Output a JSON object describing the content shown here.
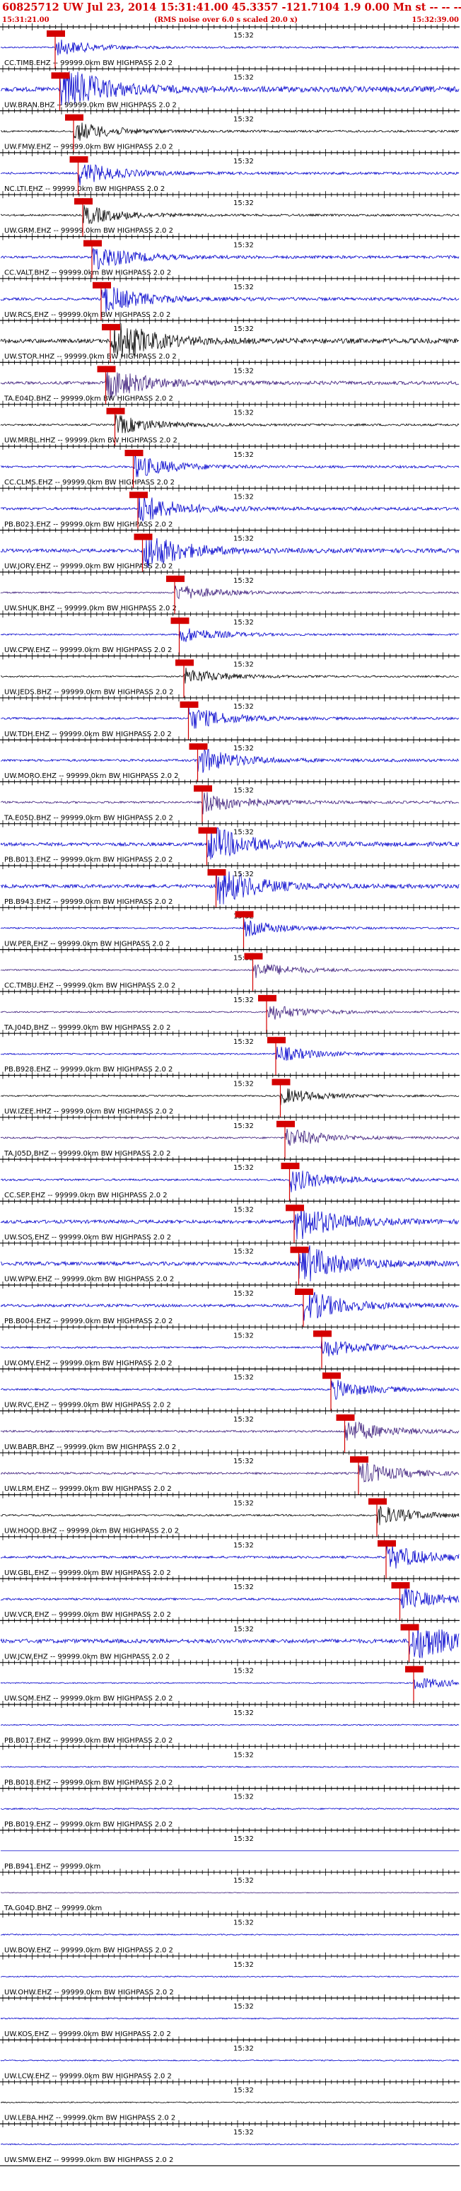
{
  "header": {
    "title": "60825712 UW Jul 23, 2014 15:31:41.00    45.3357 -121.7104   1.9 0.00 Mn st -- -- -- - -1",
    "start_time": "15:31:21.00",
    "rms_note": "(RMS noise over 6.0 s scaled 20.0 x)",
    "end_time": "15:32:39.00"
  },
  "colors": {
    "header": "#d40000",
    "pick": "#d40000",
    "mid_time": "#000000"
  },
  "mid_time_label": "15:32",
  "chart_data": {
    "type": "seismogram-record-section",
    "time_range": [
      "15:31:21.00",
      "15:32:39.00"
    ],
    "grid": true,
    "traces": [
      {
        "label": "CC.TIMB.EHZ -- 99999.0km BW  HIGHPASS  2.0  2",
        "color": "#0000cc",
        "pick": 0.12,
        "amp": 0.5
      },
      {
        "label": "UW.BRAN.BHZ -- 99999.0km BW  HIGHPASS  2.0  2",
        "color": "#0000cc",
        "pick": 0.13,
        "amp": 1.6
      },
      {
        "label": "UW.FMW.EHZ -- 99999.0km BW  HIGHPASS  2.0  2",
        "color": "#000000",
        "pick": 0.16,
        "amp": 0.6
      },
      {
        "label": "NC.LTI.EHZ -- 99999.0km BW  HIGHPASS  2.0  2",
        "color": "#0000cc",
        "pick": 0.17,
        "amp": 0.7
      },
      {
        "label": "UW.GRM.EHZ -- 99999.0km BW  HIGHPASS  2.0  2",
        "color": "#000000",
        "pick": 0.18,
        "amp": 0.6
      },
      {
        "label": "CC.VALT.BHZ -- 99999.0km BW  HIGHPASS  2.0  2",
        "color": "#0000cc",
        "pick": 0.2,
        "amp": 0.8
      },
      {
        "label": "UW.RCS.EHZ -- 99999.0km BW  HIGHPASS  2.0  2",
        "color": "#0000cc",
        "pick": 0.22,
        "amp": 0.9
      },
      {
        "label": "UW.STOR.HHZ -- 99999.0km BW  HIGHPASS  2.0  2",
        "color": "#000000",
        "pick": 0.24,
        "amp": 1.4
      },
      {
        "label": "TA.E04D.BHZ -- 99999.0km BW  HIGHPASS  2.0  2",
        "color": "#3a1a7a",
        "pick": 0.23,
        "amp": 1.0
      },
      {
        "label": "UW.MRBL.HHZ -- 99999.0km BW  HIGHPASS  2.0  2",
        "color": "#000000",
        "pick": 0.25,
        "amp": 0.6
      },
      {
        "label": "CC.CLMS.EHZ -- 99999.0km BW  HIGHPASS  2.0  2",
        "color": "#0000cc",
        "pick": 0.29,
        "amp": 0.7
      },
      {
        "label": "PB.B023.EHZ -- 99999.0km BW  HIGHPASS  2.0  2",
        "color": "#0000cc",
        "pick": 0.3,
        "amp": 0.9
      },
      {
        "label": "UW.JORV.EHZ -- 99999.0km BW  HIGHPASS  2.0  2",
        "color": "#0000cc",
        "pick": 0.31,
        "amp": 1.2
      },
      {
        "label": "UW.SHUK.BHZ -- 99999.0km BW  HIGHPASS  2.0  2",
        "color": "#3a1a7a",
        "pick": 0.38,
        "amp": 0.5
      },
      {
        "label": "UW.CPW.EHZ -- 99999.0km BW  HIGHPASS  2.0  2",
        "color": "#0000cc",
        "pick": 0.39,
        "amp": 0.5
      },
      {
        "label": "UW.JEDS.BHZ -- 99999.0km BW  HIGHPASS  2.0  2",
        "color": "#000000",
        "pick": 0.4,
        "amp": 0.5
      },
      {
        "label": "UW.TDH.EHZ -- 99999.0km BW  HIGHPASS  2.0  2",
        "color": "#0000cc",
        "pick": 0.41,
        "amp": 0.7
      },
      {
        "label": "UW.MORO.EHZ -- 99999.0km BW  HIGHPASS  2.0  2",
        "color": "#0000cc",
        "pick": 0.43,
        "amp": 0.8
      },
      {
        "label": "TA.E05D.BHZ -- 99999.0km BW  HIGHPASS  2.0  2",
        "color": "#3a1a7a",
        "pick": 0.44,
        "amp": 0.7
      },
      {
        "label": "PB.B013.EHZ -- 99999.0km BW  HIGHPASS  2.0  2",
        "color": "#0000cc",
        "pick": 0.45,
        "amp": 1.2
      },
      {
        "label": "PB.B943.EHZ -- 99999.0km BW  HIGHPASS  2.0  2",
        "color": "#0000cc",
        "pick": 0.47,
        "amp": 1.2
      },
      {
        "label": "UW.PER.EHZ -- 99999.0km BW  HIGHPASS  2.0  2",
        "color": "#0000cc",
        "pick": 0.53,
        "amp": 0.5
      },
      {
        "label": "CC.TMBU.EHZ -- 99999.0km BW  HIGHPASS  2.0  2",
        "color": "#3a1a7a",
        "pick": 0.55,
        "amp": 0.5
      },
      {
        "label": "TA.J04D.BHZ -- 99999.0km BW  HIGHPASS  2.0  2",
        "color": "#3a1a7a",
        "pick": 0.58,
        "amp": 0.5
      },
      {
        "label": "PB.B928.EHZ -- 99999.0km BW  HIGHPASS  2.0  2",
        "color": "#0000cc",
        "pick": 0.6,
        "amp": 0.5
      },
      {
        "label": "UW.IZEE.HHZ -- 99999.0km BW  HIGHPASS  2.0  2",
        "color": "#000000",
        "pick": 0.61,
        "amp": 0.5
      },
      {
        "label": "TA.J05D.BHZ -- 99999.0km BW  HIGHPASS  2.0  2",
        "color": "#3a1a7a",
        "pick": 0.62,
        "amp": 0.6
      },
      {
        "label": "CC.SEP.EHZ -- 99999.0km BW  HIGHPASS  2.0  2",
        "color": "#0000cc",
        "pick": 0.63,
        "amp": 0.7
      },
      {
        "label": "UW.SOS.EHZ -- 99999.0km BW  HIGHPASS  2.0  2",
        "color": "#0000cc",
        "pick": 0.64,
        "amp": 1.2
      },
      {
        "label": "UW.WPW.EHZ -- 99999.0km BW  HIGHPASS  2.0  2",
        "color": "#0000cc",
        "pick": 0.65,
        "amp": 1.3
      },
      {
        "label": "PB.B004.EHZ -- 99999.0km BW  HIGHPASS  2.0  2",
        "color": "#0000cc",
        "pick": 0.66,
        "amp": 1.0
      },
      {
        "label": "UW.OMV.EHZ -- 99999.0km BW  HIGHPASS  2.0  2",
        "color": "#0000cc",
        "pick": 0.7,
        "amp": 0.6
      },
      {
        "label": "UW.RVC.EHZ -- 99999.0km BW  HIGHPASS  2.0  2",
        "color": "#0000cc",
        "pick": 0.72,
        "amp": 0.6
      },
      {
        "label": "UW.BABR.BHZ -- 99999.0km BW  HIGHPASS  2.0  2",
        "color": "#3a1a7a",
        "pick": 0.75,
        "amp": 0.7
      },
      {
        "label": "UW.LRM.EHZ -- 99999.0km BW  HIGHPASS  2.0  2",
        "color": "#3a1a7a",
        "pick": 0.78,
        "amp": 0.7
      },
      {
        "label": "UW.HOOD.BHZ -- 99999.0km BW  HIGHPASS  2.0  2",
        "color": "#000000",
        "pick": 0.82,
        "amp": 0.6
      },
      {
        "label": "UW.GBL.EHZ -- 99999.0km BW  HIGHPASS  2.0  2",
        "color": "#0000cc",
        "pick": 0.84,
        "amp": 0.8
      },
      {
        "label": "UW.VCR.EHZ -- 99999.0km BW  HIGHPASS  2.0  2",
        "color": "#0000cc",
        "pick": 0.87,
        "amp": 0.7
      },
      {
        "label": "UW.JCW.EHZ -- 99999.0km BW  HIGHPASS  2.0  2",
        "color": "#0000cc",
        "pick": 0.89,
        "amp": 1.4
      },
      {
        "label": "UW.SQM.EHZ -- 99999.0km BW  HIGHPASS  2.0  2",
        "color": "#0000cc",
        "pick": 0.9,
        "amp": 0.4
      },
      {
        "label": "PB.B017.EHZ -- 99999.0km BW  HIGHPASS  2.0  2",
        "color": "#0000cc",
        "pick": null,
        "amp": 0.4
      },
      {
        "label": "PB.B018.EHZ -- 99999.0km BW  HIGHPASS  2.0  2",
        "color": "#0000cc",
        "pick": null,
        "amp": 0.4
      },
      {
        "label": "PB.B019.EHZ -- 99999.0km BW  HIGHPASS  2.0  2",
        "color": "#0000cc",
        "pick": null,
        "amp": 0.5
      },
      {
        "label": "PB.B941.EHZ -- 99999.0km",
        "color": "#0000cc",
        "pick": null,
        "amp": 0.0
      },
      {
        "label": "TA.G04D.BHZ -- 99999.0km",
        "color": "#3a1a7a",
        "pick": null,
        "amp": 0.2
      },
      {
        "label": "UW.BOW.EHZ -- 99999.0km BW  HIGHPASS  2.0  2",
        "color": "#0000cc",
        "pick": null,
        "amp": 0.4
      },
      {
        "label": "UW.OHW.EHZ -- 99999.0km BW  HIGHPASS  2.0  2",
        "color": "#0000cc",
        "pick": null,
        "amp": 0.4
      },
      {
        "label": "UW.KOS.EHZ -- 99999.0km BW  HIGHPASS  2.0  2",
        "color": "#0000cc",
        "pick": null,
        "amp": 0.4
      },
      {
        "label": "UW.LCW.EHZ -- 99999.0km BW  HIGHPASS  2.0  2",
        "color": "#0000cc",
        "pick": null,
        "amp": 0.4
      },
      {
        "label": "UW.LEBA.HHZ -- 99999.0km BW  HIGHPASS  2.0  2",
        "color": "#000000",
        "pick": null,
        "amp": 0.4
      },
      {
        "label": "UW.SMW.EHZ -- 99999.0km BW  HIGHPASS  2.0  2",
        "color": "#0000cc",
        "pick": null,
        "amp": 0.4
      }
    ]
  }
}
